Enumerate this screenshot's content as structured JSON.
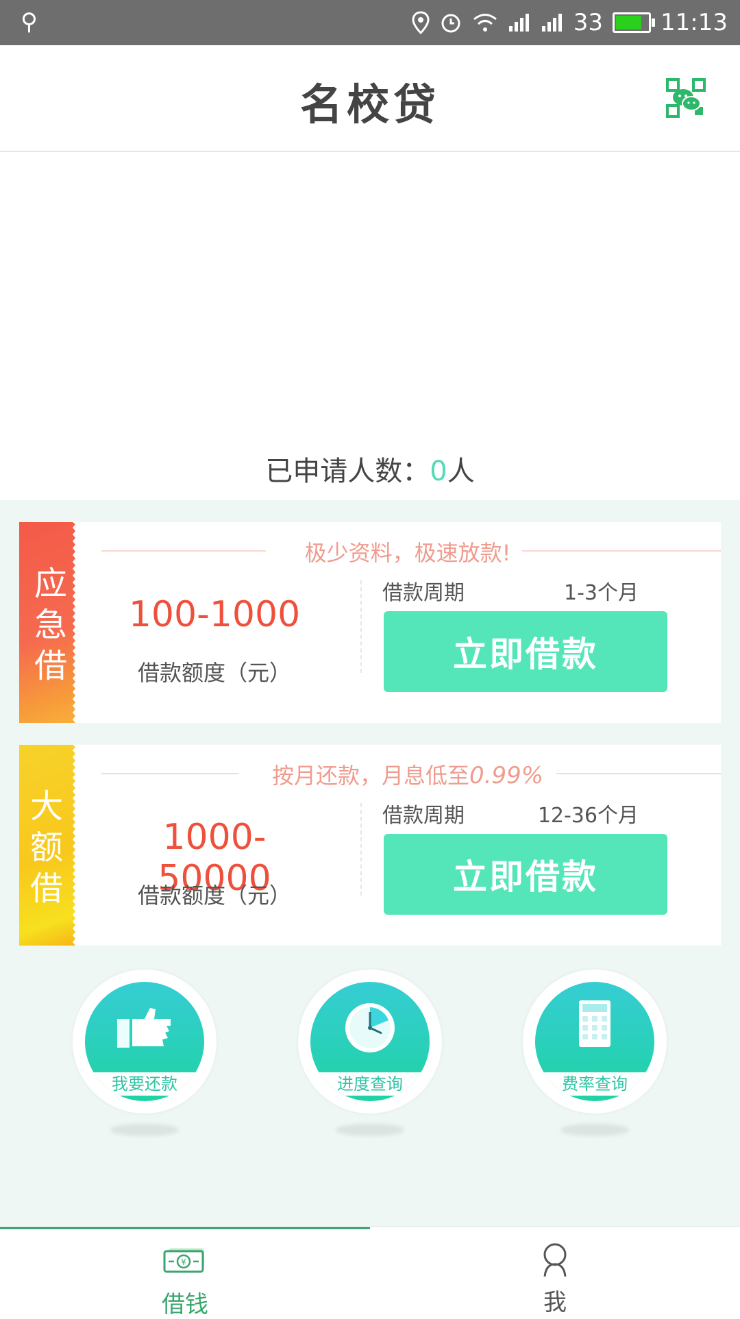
{
  "status_bar": {
    "usb_icon": "usb-icon",
    "signal_text": "33",
    "time": "11:13",
    "battery_fill": 0.8,
    "battery_color": "#29d11c"
  },
  "header": {
    "title": "名校贷",
    "qr_icon": "wechat-qr-icon"
  },
  "applied": {
    "prefix": "已申请人数：",
    "count": "0",
    "suffix": "人"
  },
  "cards": [
    {
      "ribbon": "应急借",
      "tagline": "极少资料，极速放款!",
      "amount": "100-1000",
      "amount_label": "借款额度（元）",
      "period_label": "借款周期",
      "period_value": "1-3个月",
      "button": "立即借款"
    },
    {
      "ribbon": "大额借",
      "tagline_prefix": "按月还款，月息低至",
      "tagline_rate": "0.99%",
      "amount": "1000-50000",
      "amount_label": "借款额度（元）",
      "period_label": "借款周期",
      "period_value": "12-36个月",
      "button": "立即借款"
    }
  ],
  "quick_actions": [
    {
      "label": "我要还款",
      "icon": "thumbs-up-icon"
    },
    {
      "label": "进度查询",
      "icon": "clock-icon"
    },
    {
      "label": "费率查询",
      "icon": "calculator-icon"
    }
  ],
  "tabs": [
    {
      "label": "借钱",
      "icon": "money-icon",
      "active": true
    },
    {
      "label": "我",
      "icon": "user-icon",
      "active": false
    }
  ],
  "colors": {
    "accent": "#54e5b9",
    "amount_red": "#ef503c",
    "tab_active": "#3aa56d",
    "ribbon_red": "#f36a50",
    "ribbon_yellow": "#f8c81c"
  }
}
